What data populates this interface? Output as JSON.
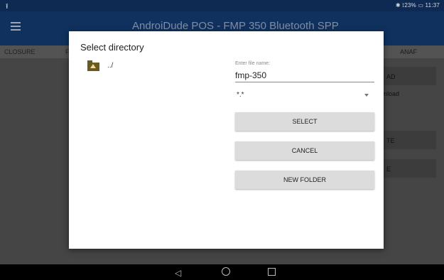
{
  "status_bar": {
    "left_icon": "usb-icon",
    "right_text": "✱ ⟟23% ▭ 11:37"
  },
  "app_bar": {
    "menu_icon": "hamburger-menu-icon",
    "title": "AndroiDude POS - FMP 350 Bluetooth SPP"
  },
  "tabs": [
    "CLOSURE",
    "F",
    "ANAF"
  ],
  "background": {
    "buttons": [
      "AD",
      "TE",
      "E"
    ],
    "text": "nload"
  },
  "dialog": {
    "title": "Select directory",
    "directory_items": [
      {
        "icon": "folder-up-icon",
        "label": "../"
      }
    ],
    "filename": {
      "label": "Enter file name:",
      "value": "fmp-350"
    },
    "filter": {
      "selected": "*.*"
    },
    "buttons": {
      "select": "SELECT",
      "cancel": "CANCEL",
      "new_folder": "NEW FOLDER"
    }
  },
  "nav_bar": {
    "back_icon": "back-triangle-icon",
    "home_icon": "home-circle-icon",
    "recents_icon": "recents-square-icon"
  },
  "colors": {
    "app_bar": "#10315e",
    "status_bar": "#0e2a52",
    "dialog_bg": "#ffffff",
    "button_bg": "#dcdcdc"
  }
}
